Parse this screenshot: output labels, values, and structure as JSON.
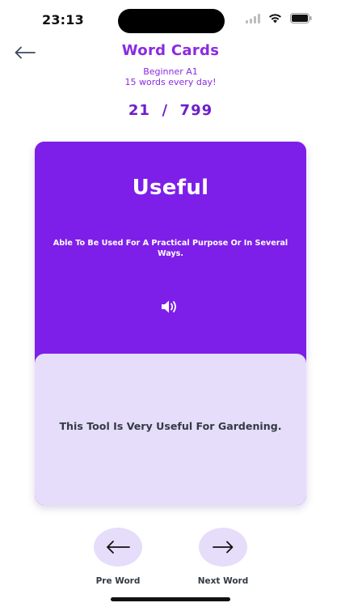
{
  "status_bar": {
    "time": "23:13"
  },
  "header": {
    "back_icon": "arrow-left-icon",
    "title": "Word Cards",
    "subtitle_line1": "Beginner A1",
    "subtitle_line2": "15 words every day!",
    "counter": "21  /  799"
  },
  "card": {
    "word": "Useful",
    "definition": "Able To Be Used For A Practical Purpose Or In Several Ways.",
    "speaker_icon": "speaker-icon",
    "example": "This Tool Is Very Useful For Gardening."
  },
  "navigation": {
    "prev_label": "Pre Word",
    "next_label": "Next Word",
    "prev_icon": "arrow-left-icon",
    "next_icon": "arrow-right-icon"
  },
  "colors": {
    "accent": "#8a2be2",
    "card_primary": "#7d1fe9",
    "card_secondary": "#e6ddfb",
    "text_dark": "#333a44"
  }
}
